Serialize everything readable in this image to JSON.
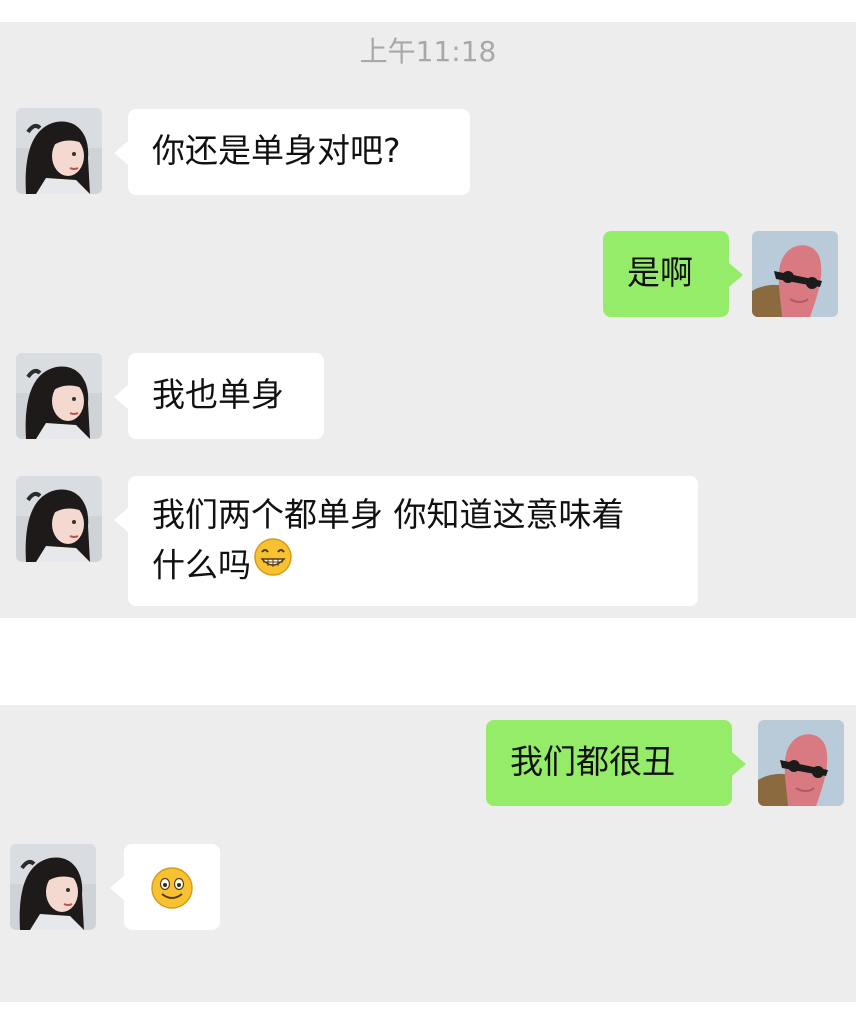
{
  "chat": {
    "timestamp": "上午11:18",
    "messages": [
      {
        "sender": "other",
        "text": "你还是单身对吧?"
      },
      {
        "sender": "me",
        "text": "是啊"
      },
      {
        "sender": "other",
        "text": "我也单身"
      },
      {
        "sender": "other",
        "lines": [
          "我们两个都单身 你知道这意味着",
          "什么吗"
        ],
        "emoji": "grinning-face-emoji"
      },
      {
        "sender": "me",
        "text": "我们都很丑"
      },
      {
        "sender": "other",
        "text": "",
        "emoji": "smiling-face-emoji"
      }
    ]
  },
  "colors": {
    "background": "#ededed",
    "incoming_bubble": "#ffffff",
    "outgoing_bubble": "#95ec69",
    "timestamp_text": "#a8a8a8"
  }
}
